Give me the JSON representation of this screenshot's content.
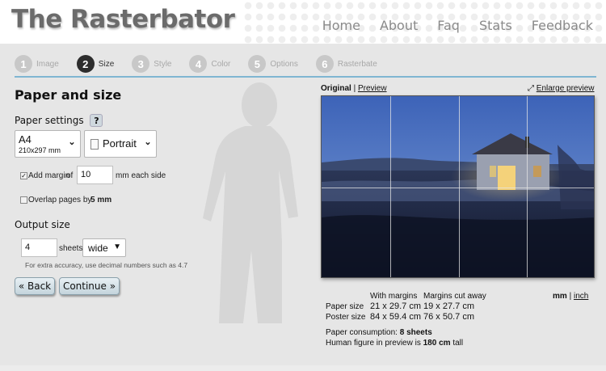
{
  "app": {
    "title": "The Rasterbator"
  },
  "nav": {
    "items": [
      "Home",
      "About",
      "Faq",
      "Stats",
      "Feedback"
    ]
  },
  "steps": [
    {
      "num": "1",
      "label": "Image",
      "active": false
    },
    {
      "num": "2",
      "label": "Size",
      "active": true
    },
    {
      "num": "3",
      "label": "Style",
      "active": false
    },
    {
      "num": "4",
      "label": "Color",
      "active": false
    },
    {
      "num": "5",
      "label": "Options",
      "active": false
    },
    {
      "num": "6",
      "label": "Rasterbate",
      "active": false
    }
  ],
  "form": {
    "heading": "Paper and size",
    "paper_settings_label": "Paper settings",
    "help_label": "?",
    "paper": {
      "name": "A4",
      "dims": "210x297 mm"
    },
    "orientation": "Portrait",
    "add_margin_checked": true,
    "add_margin_label": "Add margin",
    "of_label": "of",
    "margin_value": "10",
    "margin_unit": "mm each side",
    "overlap_checked": false,
    "overlap_label": "Overlap pages by",
    "overlap_value": "5 mm",
    "output_size_label": "Output size",
    "sheets_value": "4",
    "sheets_label": "sheets",
    "direction": "wide",
    "note": "For extra accuracy, use decimal numbers such as 4.7",
    "back_label": "« Back",
    "continue_label": "Continue »"
  },
  "preview": {
    "original_label": "Original",
    "separator": "|",
    "preview_label": "Preview",
    "enlarge_label": "Enlarge preview",
    "grid": {
      "columns": 4,
      "rows": 2
    },
    "columns_header": [
      "With margins",
      "Margins cut away"
    ],
    "paper_size_label": "Paper size",
    "paper_size": [
      "21 x 29.7 cm",
      "19 x 27.7 cm"
    ],
    "poster_size_label": "Poster size",
    "poster_size": [
      "84 x 59.4 cm",
      "76 x 50.7 cm"
    ],
    "unit_mm": "mm",
    "unit_inch": "inch",
    "consumption_label": "Paper consumption:",
    "consumption_value": "8 sheets",
    "human_label": "Human figure in preview is",
    "human_value": "180 cm",
    "human_suffix": "tall"
  }
}
